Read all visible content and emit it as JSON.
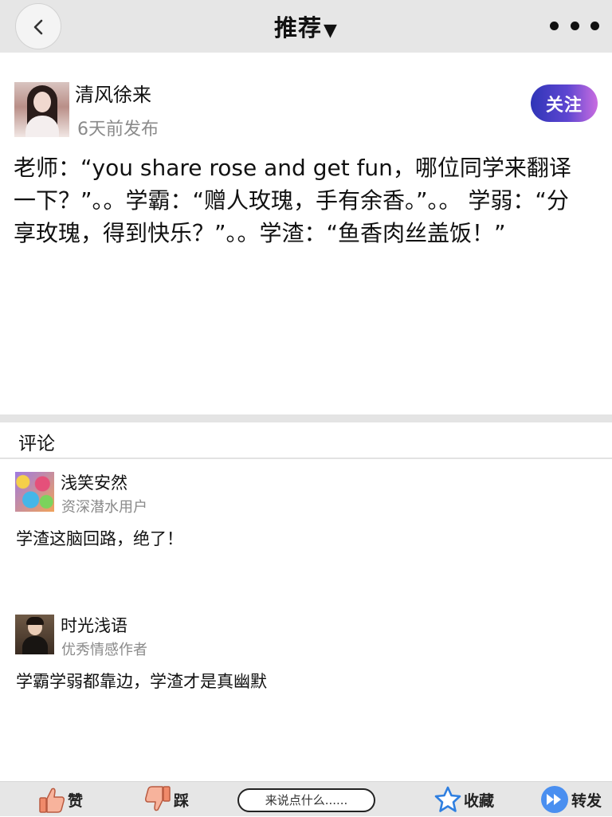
{
  "header": {
    "title": "推荐",
    "caret": "▼"
  },
  "post": {
    "author": "清风徐来",
    "time": "6天前发布",
    "follow_label": "关注",
    "content": "老师：“you share rose and get fun，哪位同学来翻译一下？”。。学霸：“赠人玫瑰，手有余香。”。。 学弱：“分享玫瑰，得到快乐？”。。学渣：“鱼香肉丝盖饭！”"
  },
  "comments": {
    "title": "评论",
    "items": [
      {
        "name": "浅笑安然",
        "role": "资深潜水用户",
        "text": "学渣这脑回路，绝了！"
      },
      {
        "name": "时光浅语",
        "role": "优秀情感作者",
        "text": "学霸学弱都靠边，学渣才是真幽默"
      }
    ]
  },
  "bottombar": {
    "like_label": "赞",
    "dislike_label": "踩",
    "input_placeholder": "来说点什么......",
    "favorite_label": "收藏",
    "share_label": "转发"
  },
  "colors": {
    "follow_gradient_start": "#2f35b7",
    "follow_gradient_end": "#c96de0",
    "like_icon": "#f08a6a",
    "star_icon": "#2f7fe0",
    "share_icon": "#4a8ff0"
  }
}
